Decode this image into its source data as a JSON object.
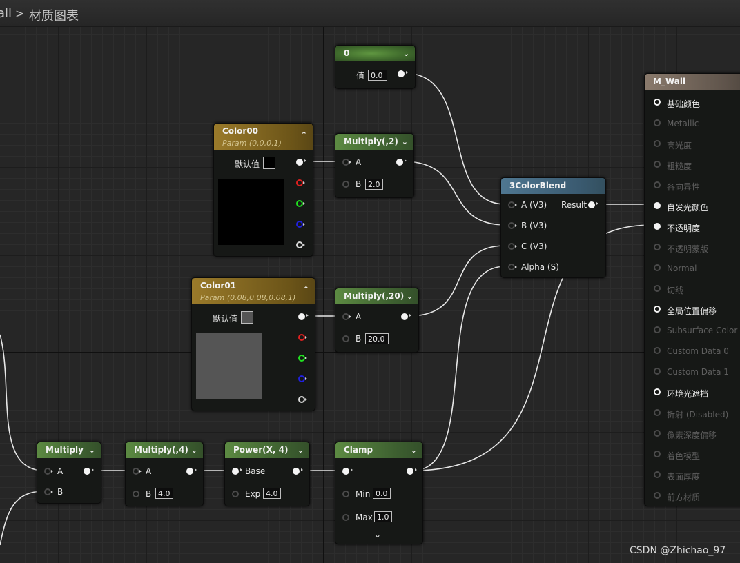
{
  "breadcrumb": {
    "parent": "all",
    "separator": ">",
    "current": "材质图表"
  },
  "nodes": {
    "const0": {
      "title": "0",
      "value_label": "值",
      "value": "0.0"
    },
    "color00": {
      "title": "Color00",
      "subtitle": "Param (0,0,0,1)",
      "default_label": "默认值",
      "color": "#000000"
    },
    "color01": {
      "title": "Color01",
      "subtitle": "Param (0.08,0.08,0.08,1)",
      "default_label": "默认值",
      "color": "#555555"
    },
    "mul2": {
      "title": "Multiply(,2)",
      "pin_a": "A",
      "pin_b": "B",
      "b_value": "2.0"
    },
    "mul20": {
      "title": "Multiply(,20)",
      "pin_a": "A",
      "pin_b": "B",
      "b_value": "20.0"
    },
    "blend": {
      "title": "3ColorBlend",
      "inputs": [
        "A (V3)",
        "B (V3)",
        "C (V3)",
        "Alpha (S)"
      ],
      "output": "Result"
    },
    "multiply": {
      "title": "Multiply",
      "pin_a": "A",
      "pin_b": "B"
    },
    "mul4": {
      "title": "Multiply(,4)",
      "pin_a": "A",
      "pin_b": "B",
      "b_value": "4.0"
    },
    "power": {
      "title": "Power(X, 4)",
      "pin_base": "Base",
      "pin_exp": "Exp",
      "exp_value": "4.0"
    },
    "clamp": {
      "title": "Clamp",
      "pin_min": "Min",
      "min_value": "0.0",
      "pin_max": "Max",
      "max_value": "1.0"
    },
    "material": {
      "title": "M_Wall",
      "pins": [
        {
          "label": "基础颜色",
          "active": true
        },
        {
          "label": "Metallic",
          "active": false
        },
        {
          "label": "高光度",
          "active": false
        },
        {
          "label": "粗糙度",
          "active": false
        },
        {
          "label": "各向异性",
          "active": false
        },
        {
          "label": "自发光颜色",
          "active": true
        },
        {
          "label": "不透明度",
          "active": true
        },
        {
          "label": "不透明蒙版",
          "active": false
        },
        {
          "label": "Normal",
          "active": false
        },
        {
          "label": "切线",
          "active": false
        },
        {
          "label": "全局位置偏移",
          "active": true
        },
        {
          "label": "Subsurface Color",
          "active": false
        },
        {
          "label": "Custom Data 0",
          "active": false
        },
        {
          "label": "Custom Data 1",
          "active": false
        },
        {
          "label": "环境光遮挡",
          "active": true
        },
        {
          "label": "折射 (Disabled)",
          "active": false
        },
        {
          "label": "像素深度偏移",
          "active": false
        },
        {
          "label": "着色模型",
          "active": false
        },
        {
          "label": "表面厚度",
          "active": false
        },
        {
          "label": "前方材质",
          "active": false
        }
      ]
    }
  },
  "watermark": "CSDN @Zhichao_97",
  "colors": {
    "wire": "#e6e6e6",
    "scalar_header": "#5c8a42",
    "param_header": "#9a7a2a",
    "function_header": "#4f7791",
    "result_header": "#8a7a6c"
  }
}
